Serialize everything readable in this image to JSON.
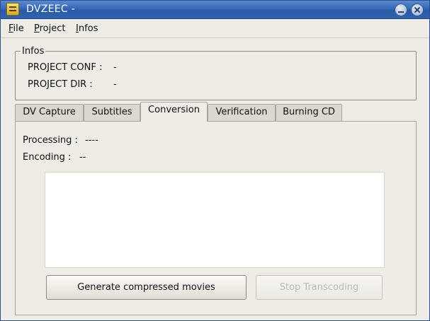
{
  "window": {
    "title": "DVZEEC -"
  },
  "menu": {
    "file": "File",
    "project": "Project",
    "infos": "Infos"
  },
  "infos": {
    "legend": "Infos",
    "project_conf_label": "PROJECT CONF :",
    "project_conf_value": "-",
    "project_dir_label": "PROJECT DIR :",
    "project_dir_value": "-"
  },
  "tabs": [
    {
      "label": "DV Capture"
    },
    {
      "label": "Subtitles"
    },
    {
      "label": "Conversion",
      "active": true
    },
    {
      "label": "Verification"
    },
    {
      "label": "Burning CD"
    }
  ],
  "conversion": {
    "processing_label": "Processing :",
    "processing_value": "----",
    "encoding_label": "Encoding :",
    "encoding_value": "--",
    "generate_button": "Generate compressed movies",
    "stop_button": "Stop Transcoding"
  }
}
